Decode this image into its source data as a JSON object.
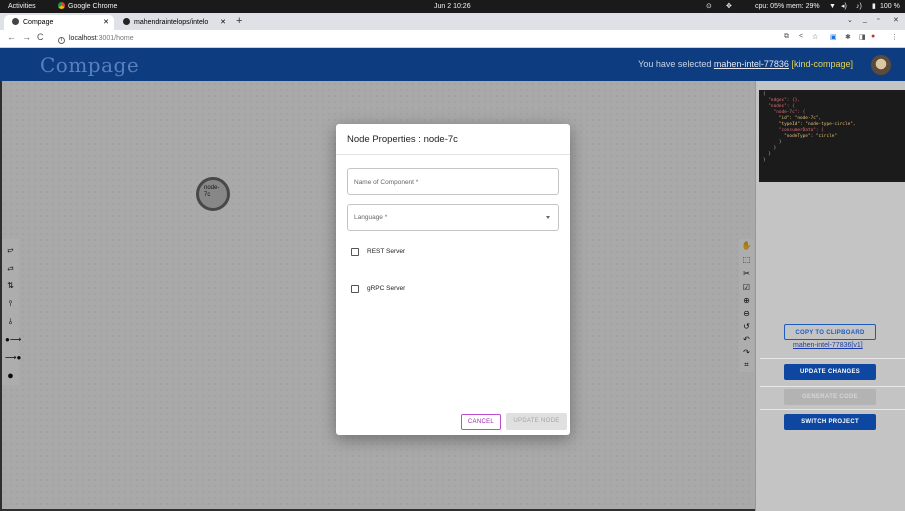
{
  "os_bar": {
    "activities": "Activities",
    "app_name": "Google Chrome",
    "datetime": "Jun 2  10:26",
    "system_stats": "cpu: 05% mem: 29%",
    "battery": "100 %"
  },
  "browser": {
    "tabs": [
      {
        "title": "Compage",
        "active": true
      },
      {
        "title": "mahendraintelops/intelo",
        "active": false
      }
    ],
    "new_tab": "+",
    "url_host": "localhost",
    "url_path": ":3001/home"
  },
  "header": {
    "logo": "Compage",
    "selected_prefix": "You have selected ",
    "project": "mahen-intel-77836",
    "context": " [kind-compage]"
  },
  "canvas": {
    "node_label": "node-\n7c"
  },
  "code_panel": {
    "lines": [
      "{",
      "  \"edges\": {},",
      "  \"nodes\": {",
      "    \"node-7c\": {",
      "      \"id\": \"node-7c\",",
      "      \"typeId\": \"node-type-circle\",",
      "      \"consumerData\": {",
      "        \"nodeType\": \"circle\"",
      "      }",
      "    }",
      "  }",
      "}"
    ]
  },
  "right_panel": {
    "copy_button": "COPY TO CLIPBOARD",
    "version_link": "mahen-intel-77836[v1]",
    "update_button": "UPDATE CHANGES",
    "generate_button": "GENERATE CODE",
    "switch_button": "SWITCH PROJECT"
  },
  "modal": {
    "title": "Node Properties : node-7c",
    "name_placeholder": "Name of Component *",
    "language_label": "Language *",
    "checkboxes": [
      {
        "label": "REST Server",
        "checked": false
      },
      {
        "label": "gRPC Server",
        "checked": false
      }
    ],
    "cancel_button": "CANCEL",
    "update_button": "UPDATE NODE"
  },
  "colors": {
    "header_bg": "#0d3d80",
    "primary": "#0d47a1",
    "cancel_accent": "#9c27b0"
  }
}
